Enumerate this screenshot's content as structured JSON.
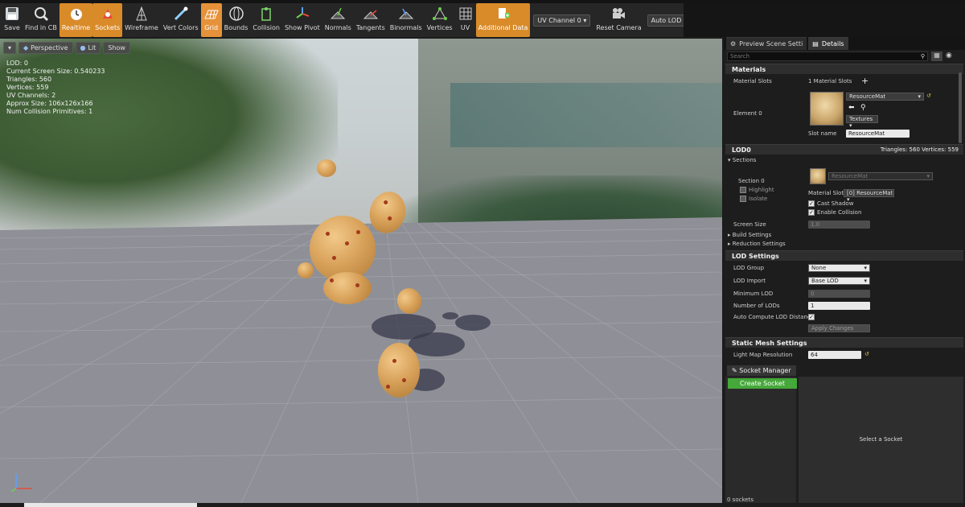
{
  "toolbar": {
    "items": [
      {
        "label": "Save",
        "icon": "save-icon"
      },
      {
        "label": "Find in CB",
        "icon": "find-icon"
      },
      {
        "label": "Realtime",
        "icon": "realtime-icon",
        "active": true
      },
      {
        "label": "Sockets",
        "icon": "sockets-icon",
        "active": true
      },
      {
        "label": "Wireframe",
        "icon": "wireframe-icon"
      },
      {
        "label": "Vert Colors",
        "icon": "vert-colors-icon"
      },
      {
        "label": "Grid",
        "icon": "grid-icon",
        "active": true
      },
      {
        "label": "Bounds",
        "icon": "bounds-icon"
      },
      {
        "label": "Collision",
        "icon": "collision-icon"
      },
      {
        "label": "Show Pivot",
        "icon": "pivot-icon"
      },
      {
        "label": "Normals",
        "icon": "normals-icon"
      },
      {
        "label": "Tangents",
        "icon": "tangents-icon"
      },
      {
        "label": "Binormals",
        "icon": "binormals-icon"
      },
      {
        "label": "Vertices",
        "icon": "vertices-icon"
      },
      {
        "label": "UV",
        "icon": "uv-icon"
      },
      {
        "label": "Additional Data",
        "icon": "additional-data-icon",
        "active": true
      }
    ],
    "uv_channel": "UV Channel 0",
    "reset_camera": "Reset Camera",
    "auto_lod": "Auto LOD"
  },
  "viewport": {
    "controls": {
      "perspective": "Perspective",
      "lit": "Lit",
      "show": "Show"
    },
    "stats": [
      "LOD:  0",
      "Current Screen Size:  0.540233",
      "Triangles:  560",
      "Vertices:  559",
      "UV Channels:  2",
      "Approx Size: 106x126x166",
      "Num Collision Primitives:  1"
    ]
  },
  "details": {
    "tabs": [
      "Preview Scene Setti",
      "Details"
    ],
    "search_placeholder": "Search",
    "materials": {
      "header": "Materials",
      "slots_label": "Material Slots",
      "slots_value": "1 Material Slots",
      "element_label": "Element 0",
      "material_name": "ResourceMat",
      "textures": "Textures",
      "slot_name_label": "Slot name",
      "slot_name_value": "ResourceMat"
    },
    "lod0": {
      "header": "LOD0",
      "summary": "Triangles: 560   Vertices: 559",
      "sections": "Sections",
      "section0": "Section 0",
      "highlight": "Highlight",
      "isolate": "Isolate",
      "material_dim": "ResourceMat",
      "material_slot_label": "Material Slot",
      "material_slot_value": "[0] ResourceMat",
      "cast_shadow": "Cast Shadow",
      "enable_collision": "Enable Collision",
      "screen_size_label": "Screen Size",
      "screen_size_value": "1.0",
      "build_settings": "Build Settings",
      "reduction_settings": "Reduction Settings"
    },
    "lod_settings": {
      "header": "LOD Settings",
      "lod_group_label": "LOD Group",
      "lod_group_value": "None",
      "lod_import_label": "LOD Import",
      "lod_import_value": "Base LOD",
      "min_lod_label": "Minimum LOD",
      "min_lod_value": "0",
      "num_lods_label": "Number of LODs",
      "num_lods_value": "1",
      "auto_compute_label": "Auto Compute LOD Distance",
      "apply_changes": "Apply Changes"
    },
    "static_mesh": {
      "header": "Static Mesh Settings",
      "light_map_label": "Light Map Resolution",
      "light_map_value": "64"
    }
  },
  "socket_manager": {
    "tab": "Socket Manager",
    "create_button": "Create Socket",
    "select_hint": "Select a Socket",
    "count": "0 sockets"
  }
}
